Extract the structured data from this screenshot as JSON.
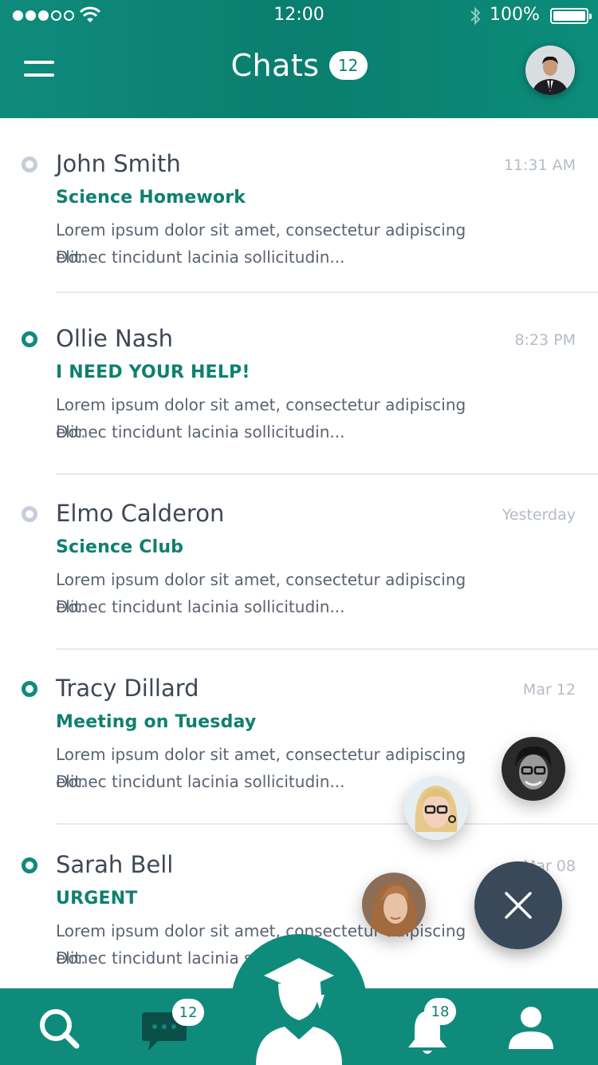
{
  "status_bar": {
    "time": "12:00",
    "battery": "100%"
  },
  "header": {
    "title": "Chats",
    "unread_count": "12"
  },
  "chats": [
    {
      "name": "John Smith",
      "time": "11:31 AM",
      "subject": "Science Homework",
      "line1": "Lorem ipsum dolor sit amet, consectetur adipiscing elit.",
      "line2": "Donec tincidunt lacinia sollicitudin...",
      "unread": false
    },
    {
      "name": "Ollie Nash",
      "time": "8:23 PM",
      "subject": "I NEED YOUR HELP!",
      "line1": "Lorem ipsum dolor sit amet, consectetur adipiscing elit.",
      "line2": "Donec tincidunt lacinia sollicitudin...",
      "unread": true
    },
    {
      "name": "Elmo Calderon",
      "time": "Yesterday",
      "subject": "Science Club",
      "line1": "Lorem ipsum dolor sit amet, consectetur adipiscing elit.",
      "line2": "Donec tincidunt lacinia sollicitudin...",
      "unread": false
    },
    {
      "name": "Tracy Dillard",
      "time": "Mar 12",
      "subject": "Meeting on Tuesday",
      "line1": "Lorem ipsum dolor sit amet, consectetur adipiscing elit.",
      "line2": "Donec tincidunt lacinia sollicitudin...",
      "unread": true
    },
    {
      "name": "Sarah Bell",
      "time": "Mar 08",
      "subject": "URGENT",
      "line1": "Lorem ipsum dolor sit amet, consectetur adipiscing elit.",
      "line2": "Donec tincidunt lacinia sollicitudin...",
      "unread": true
    }
  ],
  "bottom_nav": {
    "messages_badge": "12",
    "notifications_badge": "18"
  },
  "icons": {
    "menu": "hamburger-icon",
    "search": "search-icon",
    "messages": "chat-bubble-icon",
    "home": "graduate-icon",
    "notifications": "bell-icon",
    "profile": "person-icon",
    "close": "close-icon"
  },
  "colors": {
    "primary": "#0f8b7c",
    "accent_text": "#0f8070",
    "fab": "#39495a",
    "muted": "#b5bcc6"
  }
}
